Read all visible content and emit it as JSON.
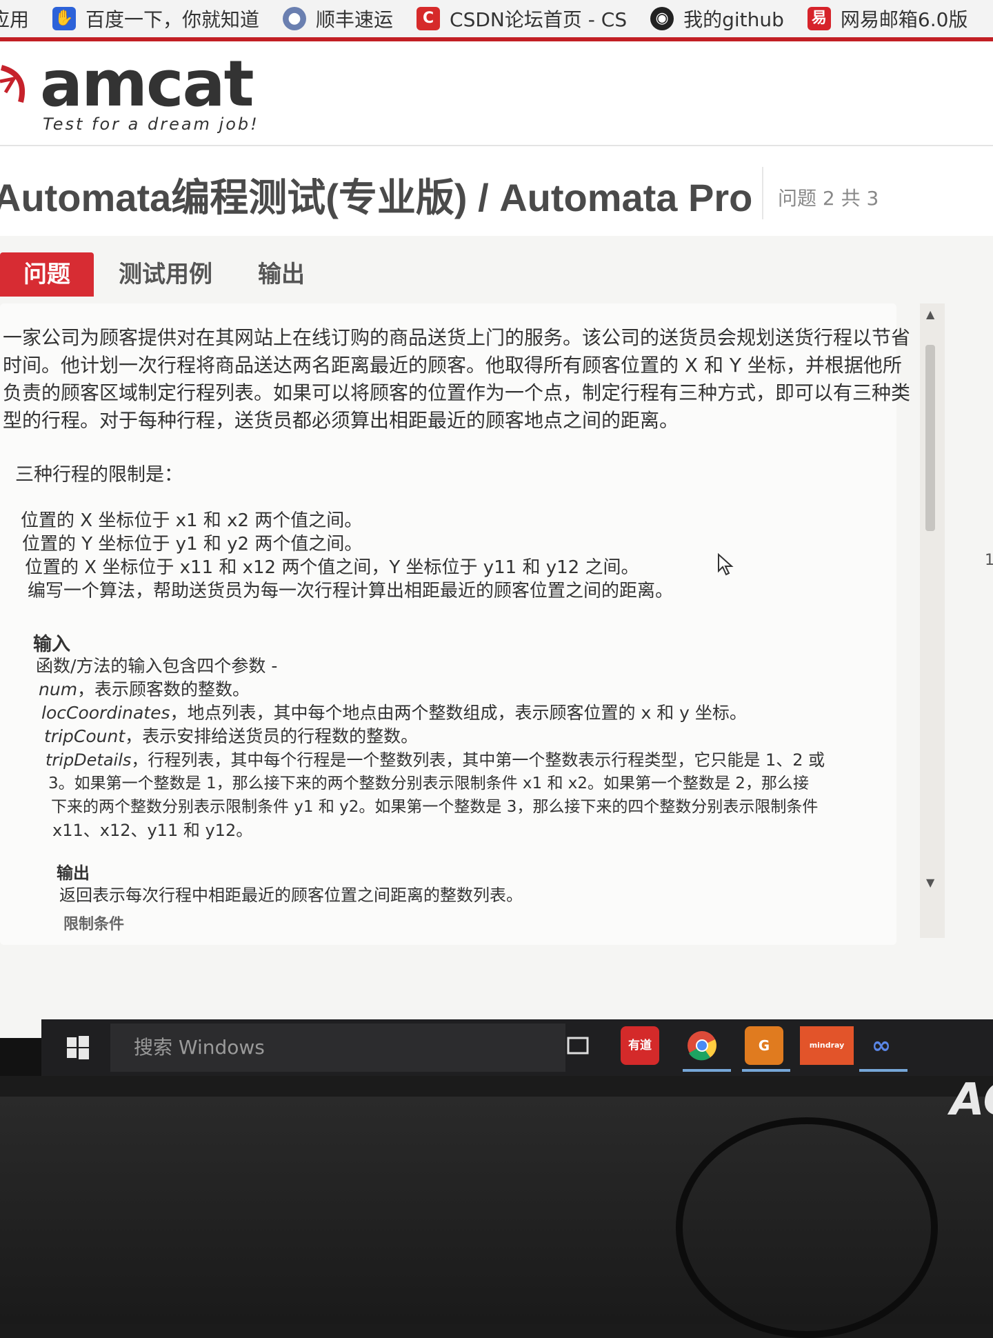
{
  "bookmarks": [
    {
      "label": "应用",
      "icon": "apps-icon"
    },
    {
      "label": "百度一下，你就知道",
      "icon": "baidu-paw-icon"
    },
    {
      "label": "顺丰速运",
      "icon": "sf-express-icon"
    },
    {
      "label": "CSDN论坛首页 - CS",
      "icon": "csdn-icon"
    },
    {
      "label": "我的github",
      "icon": "github-icon"
    },
    {
      "label": "网易邮箱6.0版",
      "icon": "netease-mail-icon"
    }
  ],
  "brand": {
    "logo": "amcat",
    "tagline": "Test for a dream job!",
    "accent": "#c6222b"
  },
  "page": {
    "title": "Automata编程测试(专业版) / Automata Pro",
    "question_counter": "问题 2 共 3"
  },
  "tabs": [
    "问题",
    "测试用例",
    "输出"
  ],
  "problem": {
    "intro": "一家公司为顾客提供对在其网站上在线订购的商品送货上门的服务。该公司的送货员会规划送货行程以节省时间。他计划一次行程将商品送达两名距离最近的顾客。他取得所有顾客位置的 X 和 Y 坐标，并根据他所负责的顾客区域制定行程列表。如果可以将顾客的位置作为一个点，制定行程有三种方式，即可以有三种类型的行程。对于每种行程，送货员都必须算出相距最近的顾客地点之间的距离。",
    "limits_heading": "三种行程的限制是：",
    "limits": [
      "位置的 X 坐标位于 x1 和 x2 两个值之间。",
      "位置的 Y 坐标位于 y1 和 y2 两个值之间。",
      "位置的 X 坐标位于 x11 和 x12 两个值之间，Y 坐标位于 y11 和 y12 之间。",
      "编写一个算法，帮助送货员为每一次行程计算出相距最近的顾客位置之间的距离。"
    ],
    "input_heading": "输入",
    "input_intro": "函数/方法的输入包含四个参数 -",
    "params": [
      {
        "name": "num",
        "desc": "，表示顾客数的整数。"
      },
      {
        "name": "locCoordinates",
        "desc": "，地点列表，其中每个地点由两个整数组成，表示顾客位置的 x 和 y 坐标。"
      },
      {
        "name": "tripCount",
        "desc": "，表示安排给送货员的行程数的整数。"
      },
      {
        "name": "tripDetails",
        "desc": "，行程列表，其中每个行程是一个整数列表，其中第一个整数表示行程类型，它只能是 1、2 或"
      }
    ],
    "trip_details_cont": [
      "3。如果第一个整数是 1，那么接下来的两个整数分别表示限制条件 x1 和 x2。如果第一个整数是 2，那么接",
      "下来的两个整数分别表示限制条件 y1 和 y2。如果第一个整数是 3，那么接下来的四个整数分别表示限制条件",
      "x11、x12、y11 和 y12。"
    ],
    "output_heading": "输出",
    "output_text": "返回表示每次行程中相距最近的顾客位置之间距离的整数列表。",
    "constraints_heading": "限制条件"
  },
  "side_number": "1",
  "taskbar": {
    "search_placeholder": "搜索 Windows",
    "apps": [
      {
        "name": "task-view-icon",
        "label": ""
      },
      {
        "name": "youdao-icon",
        "label": "有道"
      },
      {
        "name": "chrome-icon",
        "label": ""
      },
      {
        "name": "app-orange-icon",
        "label": "G"
      },
      {
        "name": "mindray-icon",
        "label": "mindray"
      },
      {
        "name": "infinity-app-icon",
        "label": ""
      }
    ]
  },
  "monitor_brand": "AO"
}
